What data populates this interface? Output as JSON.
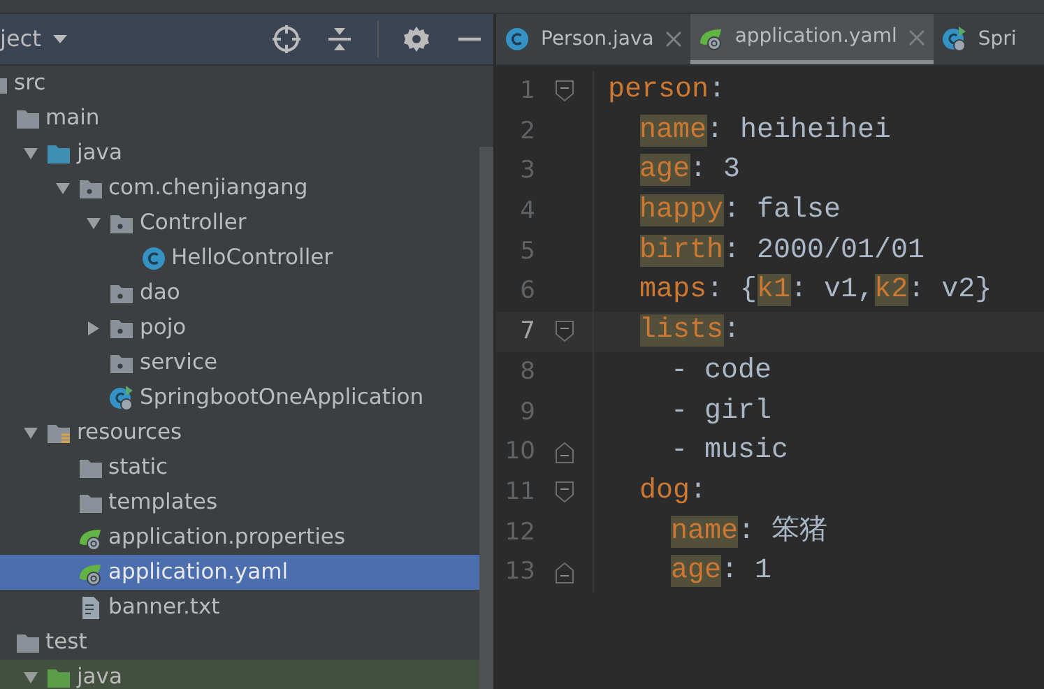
{
  "project_panel": {
    "title": "ject",
    "tree": [
      {
        "label": "src",
        "kind": "folder",
        "selected": false,
        "children": [
          {
            "label": "main",
            "kind": "folder",
            "selected": false,
            "children": [
              {
                "label": "java",
                "kind": "source-folder",
                "selected": false,
                "expanded": true,
                "children": [
                  {
                    "label": "com.chenjiangang",
                    "kind": "package",
                    "selected": false,
                    "expanded": true,
                    "children": [
                      {
                        "label": "Controller",
                        "kind": "package",
                        "selected": false,
                        "expanded": true,
                        "children": [
                          {
                            "label": "HelloController",
                            "kind": "class",
                            "selected": false
                          }
                        ]
                      },
                      {
                        "label": "dao",
                        "kind": "package",
                        "selected": false
                      },
                      {
                        "label": "pojo",
                        "kind": "package",
                        "selected": false,
                        "expanded": false
                      },
                      {
                        "label": "service",
                        "kind": "package",
                        "selected": false
                      },
                      {
                        "label": "SpringbootOneApplication",
                        "kind": "spring-app",
                        "selected": false
                      }
                    ]
                  }
                ]
              },
              {
                "label": "resources",
                "kind": "resources",
                "selected": false,
                "expanded": true,
                "children": [
                  {
                    "label": "static",
                    "kind": "folder",
                    "selected": false
                  },
                  {
                    "label": "templates",
                    "kind": "folder",
                    "selected": false
                  },
                  {
                    "label": "application.properties",
                    "kind": "spring-config",
                    "selected": false
                  },
                  {
                    "label": "application.yaml",
                    "kind": "spring-config",
                    "selected": true
                  },
                  {
                    "label": "banner.txt",
                    "kind": "text-file",
                    "selected": false
                  }
                ]
              }
            ]
          },
          {
            "label": "test",
            "kind": "folder",
            "selected": false,
            "children": [
              {
                "label": "java",
                "kind": "test-folder",
                "selected": false,
                "expanded": true
              }
            ]
          }
        ]
      }
    ]
  },
  "editor": {
    "tabs": [
      {
        "label": "Person.java",
        "kind": "class",
        "selected": false,
        "closable": true
      },
      {
        "label": "application.yaml",
        "kind": "spring-config",
        "selected": true,
        "closable": true
      },
      {
        "label": "Spri",
        "kind": "spring-app",
        "selected": false,
        "closable": false
      }
    ],
    "lines": [
      {
        "number": "1",
        "kind": "fold-start",
        "current": false,
        "tokens": [
          {
            "text": "person",
            "kind": "key",
            "highlighted": false
          },
          {
            "text": ":",
            "kind": "value"
          }
        ],
        "children": [
          {
            "number": "2",
            "kind": "plain",
            "current": false,
            "tokens": [
              {
                "text": "name",
                "kind": "key",
                "highlighted": true
              },
              {
                "text": ": heiheihei",
                "kind": "value"
              }
            ]
          },
          {
            "number": "3",
            "kind": "plain",
            "current": false,
            "tokens": [
              {
                "text": "age",
                "kind": "key",
                "highlighted": true
              },
              {
                "text": ": 3",
                "kind": "value"
              }
            ]
          },
          {
            "number": "4",
            "kind": "plain",
            "current": false,
            "tokens": [
              {
                "text": "happy",
                "kind": "key",
                "highlighted": true
              },
              {
                "text": ": false",
                "kind": "value"
              }
            ]
          },
          {
            "number": "5",
            "kind": "plain",
            "current": false,
            "tokens": [
              {
                "text": "birth",
                "kind": "key",
                "highlighted": true
              },
              {
                "text": ": 2000/01/01",
                "kind": "value"
              }
            ]
          },
          {
            "number": "6",
            "kind": "plain",
            "current": false,
            "tokens": [
              {
                "text": "maps",
                "kind": "key",
                "highlighted": false
              },
              {
                "text": ": {",
                "kind": "value"
              },
              {
                "text": "k1",
                "kind": "key",
                "highlighted": true
              },
              {
                "text": ": v1,",
                "kind": "value"
              },
              {
                "text": "k2",
                "kind": "key",
                "highlighted": true
              },
              {
                "text": ": v2}",
                "kind": "value"
              }
            ]
          },
          {
            "number": "7",
            "kind": "fold-start",
            "current": true,
            "tokens": [
              {
                "text": "lists",
                "kind": "key",
                "highlighted": true
              },
              {
                "text": ":",
                "kind": "value"
              }
            ],
            "children": [
              {
                "number": "8",
                "kind": "plain",
                "current": false,
                "tokens": [
                  {
                    "text": "- code",
                    "kind": "value"
                  }
                ]
              },
              {
                "number": "9",
                "kind": "plain",
                "current": false,
                "tokens": [
                  {
                    "text": "- girl",
                    "kind": "value"
                  }
                ]
              },
              {
                "number": "10",
                "kind": "fold-end",
                "current": false,
                "tokens": [
                  {
                    "text": "- music",
                    "kind": "value"
                  }
                ]
              }
            ]
          },
          {
            "number": "11",
            "kind": "fold-start",
            "current": false,
            "tokens": [
              {
                "text": "dog",
                "kind": "key",
                "highlighted": false
              },
              {
                "text": ":",
                "kind": "value"
              }
            ],
            "children": [
              {
                "number": "12",
                "kind": "plain",
                "current": false,
                "tokens": [
                  {
                    "text": "name",
                    "kind": "key",
                    "highlighted": true
                  },
                  {
                    "text": ": 笨猪",
                    "kind": "value"
                  }
                ]
              },
              {
                "number": "13",
                "kind": "fold-end",
                "current": false,
                "tokens": [
                  {
                    "text": "age",
                    "kind": "key",
                    "highlighted": true
                  },
                  {
                    "text": ": 1",
                    "kind": "value"
                  }
                ]
              }
            ]
          }
        ]
      }
    ]
  }
}
